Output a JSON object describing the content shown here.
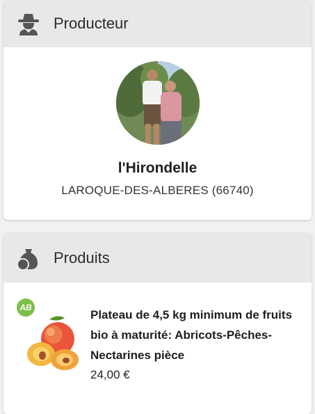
{
  "producer_section": {
    "title": "Producteur",
    "icon": "farmer-icon",
    "name": "l'Hirondelle",
    "location": "LAROQUE-DES-ALBERES (66740)"
  },
  "products_section": {
    "title": "Produits",
    "icon": "produce-bag-icon",
    "items": [
      {
        "badge": "AB",
        "name": "Plateau de 4,5 kg minimum de fruits bio à maturité: Abricots-Pêches-Nectarines pièce",
        "price": "24,00 €"
      }
    ]
  },
  "colors": {
    "header_bg": "#e8e8e8",
    "icon": "#555555",
    "bio_green": "#7cbf4a"
  }
}
